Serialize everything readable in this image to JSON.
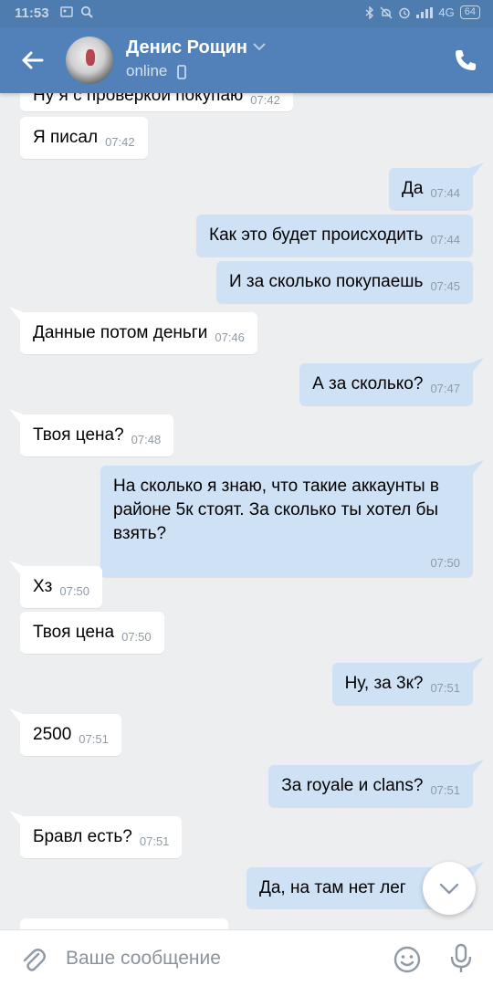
{
  "status_bar": {
    "time": "11:53",
    "network": "4G",
    "battery": "64"
  },
  "header": {
    "name": "Денис Рощин",
    "status": "online"
  },
  "messages": [
    {
      "dir": "in",
      "text": "Ну я с проверкой покупаю",
      "time": "07:42"
    },
    {
      "dir": "in",
      "text": "Я писал",
      "time": "07:42"
    },
    {
      "dir": "out",
      "text": "Да",
      "time": "07:44"
    },
    {
      "dir": "out",
      "text": "Как это будет происходить",
      "time": "07:44"
    },
    {
      "dir": "out",
      "text": "И за сколько покупаешь",
      "time": "07:45"
    },
    {
      "dir": "in",
      "text": "Данные потом деньги",
      "time": "07:46"
    },
    {
      "dir": "out",
      "text": "А за сколько?",
      "time": "07:47"
    },
    {
      "dir": "in",
      "text": "Твоя цена?",
      "time": "07:48"
    },
    {
      "dir": "out",
      "text": "На сколько я знаю, что такие аккаунты в районе 5к стоят. За сколько ты хотел бы взять?",
      "time": "07:50"
    },
    {
      "dir": "in",
      "text": "Хз",
      "time": "07:50"
    },
    {
      "dir": "in",
      "text": "Твоя цена",
      "time": "07:50"
    },
    {
      "dir": "out",
      "text": "Ну, за 3к?",
      "time": "07:51"
    },
    {
      "dir": "in",
      "text": "2500",
      "time": "07:51"
    },
    {
      "dir": "out",
      "text": "За royale и clans?",
      "time": "07:51"
    },
    {
      "dir": "in",
      "text": "Бравл есть?",
      "time": "07:51"
    },
    {
      "dir": "out",
      "text": "Да, на там нет лег",
      "time": ""
    }
  ],
  "composer": {
    "placeholder": "Ваше сообщение"
  },
  "colors": {
    "header": "#5181b8",
    "background": "#edeef0",
    "incoming": "#ffffff",
    "outgoing": "#cfe1f5"
  },
  "icons": [
    "back-arrow-icon",
    "chevron-down-icon",
    "phone-icon",
    "attach-icon",
    "emoji-icon",
    "mic-icon",
    "chevron-down-icon"
  ]
}
